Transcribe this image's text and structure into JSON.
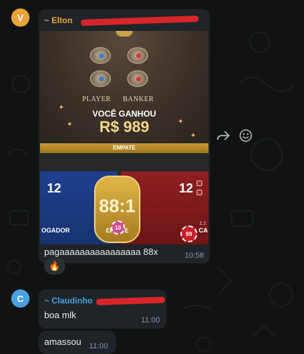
{
  "colors": {
    "background": "#111312",
    "bubble": "#1f2428",
    "elton_name": "#e8a33a",
    "claudinho_name": "#4aa0e0",
    "timestamp": "#8696a0"
  },
  "messages": [
    {
      "avatar_letter": "V",
      "sender": "~ Elton",
      "media": {
        "cup_labels": [
          "PLAYER",
          "BANKER"
        ],
        "win_title": "VOCÊ GANHOU",
        "win_amount": "R$ 989",
        "result_banner": "EMPATE",
        "player_score": "12",
        "banker_score": "12",
        "player_label": "OGADOR",
        "banker_label": "CA",
        "multiplier": "88:1",
        "multiplier_label": "EMPATE",
        "chip_player": "10",
        "chip_banker": "99",
        "side_multiplier": "1:1"
      },
      "text": "pagaaaaaaaaaaaaaaaa 88x",
      "time": "10:58",
      "reaction": "🔥"
    },
    {
      "avatar_letter": "C",
      "sender": "~ Claudinho",
      "text": "boa mlk",
      "time": "11:00"
    },
    {
      "text": "amassou",
      "time": "11:00"
    }
  ],
  "icons": {
    "forward": "forward-icon",
    "emoji": "emoji-icon"
  }
}
